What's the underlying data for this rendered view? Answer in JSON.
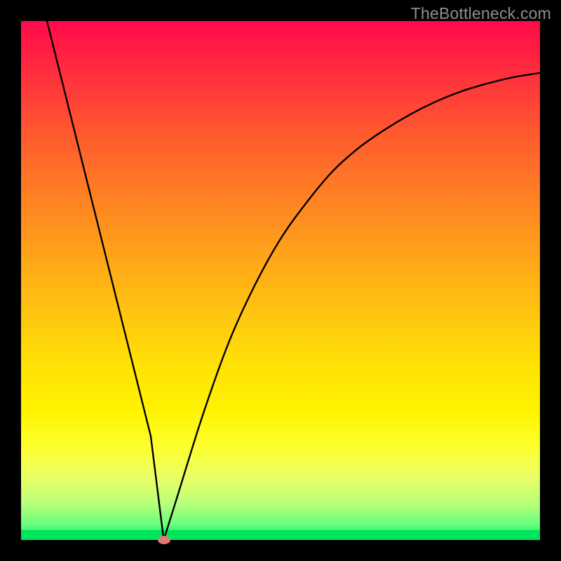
{
  "watermark": "TheBottleneck.com",
  "chart_data": {
    "type": "line",
    "title": "",
    "xlabel": "",
    "ylabel": "",
    "xlim": [
      0,
      100
    ],
    "ylim": [
      0,
      100
    ],
    "grid": false,
    "legend": false,
    "background_gradient": {
      "top": "#ff0a4a",
      "middle": "#ffe106",
      "bottom": "#00e85e"
    },
    "series": [
      {
        "name": "bottleneck-curve",
        "x": [
          5,
          10,
          15,
          20,
          25,
          27.5,
          30,
          35,
          40,
          45,
          50,
          55,
          60,
          65,
          70,
          75,
          80,
          85,
          90,
          95,
          100
        ],
        "values": [
          100,
          80,
          60,
          40,
          20,
          0,
          8,
          24,
          38,
          49,
          58,
          65,
          71,
          75.5,
          79,
          82,
          84.5,
          86.5,
          88,
          89.2,
          90
        ]
      }
    ],
    "marker": {
      "x": 27.5,
      "y": 0,
      "color": "#e07a78"
    },
    "annotations": []
  }
}
